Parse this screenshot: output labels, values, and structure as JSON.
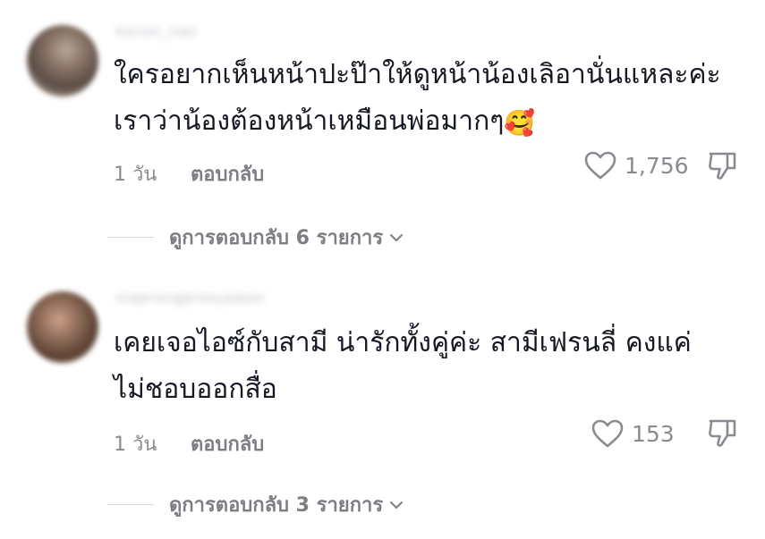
{
  "comments": [
    {
      "username": "kanan_nae",
      "text_line1": "ใครอยากเห็นหน้าปะป๊าให้ดูหน้าน้องเลิอานั่นแหละค่ะ",
      "text_line2": "เราว่าน้องต้องหน้าเหมือนพ่อมากๆ",
      "emoji": "🥰",
      "time": "1 วัน",
      "reply_label": "ตอบกลับ",
      "likes": "1,756",
      "view_replies": "ดูการตอบกลับ 6 รายการ"
    },
    {
      "username": "maprangpreeyawan",
      "text_line1": "เคยเจอไอซ์กับสามี น่ารักทั้งคู่ค่ะ สามีเฟรนลี่ คงแค่",
      "text_line2": "ไม่ชอบออกสื่อ",
      "time": "1 วัน",
      "reply_label": "ตอบกลับ",
      "likes": "153",
      "view_replies": "ดูการตอบกลับ 3 รายการ"
    }
  ],
  "icons": {
    "like": "heart-outline-icon",
    "dislike": "thumbs-down-outline-icon",
    "expand": "chevron-down-icon"
  },
  "colors": {
    "text": "#161823",
    "secondary": "#8a8b91"
  }
}
